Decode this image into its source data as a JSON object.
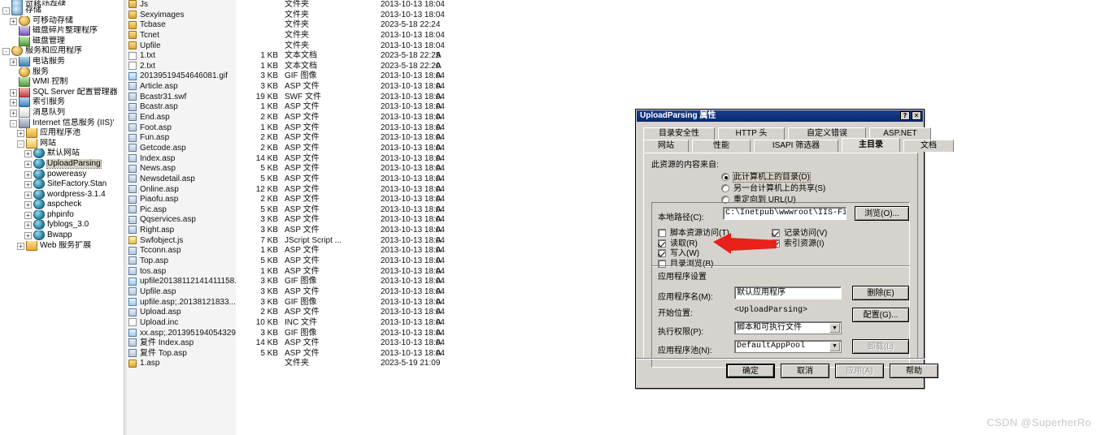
{
  "tree": {
    "items": [
      {
        "label": "可移动存储",
        "indent": 0,
        "expander": "none",
        "icon": "disk-icon",
        "cut": true
      },
      {
        "label": "存储",
        "indent": 0,
        "expander": "-",
        "icon": "disk-icon"
      },
      {
        "label": "可移动存储",
        "indent": 1,
        "expander": "+",
        "icon": "gear-icon"
      },
      {
        "label": "磁盘碎片整理程序",
        "indent": 1,
        "expander": "none",
        "icon": "purple-icon"
      },
      {
        "label": "磁盘管理",
        "indent": 1,
        "expander": "none",
        "icon": "green-icon"
      },
      {
        "label": "服务和应用程序",
        "indent": 0,
        "expander": "-",
        "icon": "gear-icon"
      },
      {
        "label": "电话服务",
        "indent": 1,
        "expander": "+",
        "icon": "blue-icon"
      },
      {
        "label": "服务",
        "indent": 1,
        "expander": "none",
        "icon": "gear-icon"
      },
      {
        "label": "WMI 控制",
        "indent": 1,
        "expander": "none",
        "icon": "green-icon"
      },
      {
        "label": "SQL Server 配置管理器",
        "indent": 1,
        "expander": "+",
        "icon": "red-icon"
      },
      {
        "label": "索引服务",
        "indent": 1,
        "expander": "+",
        "icon": "blue-icon"
      },
      {
        "label": "消息队列",
        "indent": 1,
        "expander": "+",
        "icon": "mail-icon"
      },
      {
        "label": "Internet 信息服务 (IIS)'",
        "indent": 1,
        "expander": "-",
        "icon": "computer-icon"
      },
      {
        "label": "应用程序池",
        "indent": 2,
        "expander": "+",
        "icon": "folder-icon"
      },
      {
        "label": "网站",
        "indent": 2,
        "expander": "-",
        "icon": "folder-open-icon"
      },
      {
        "label": "默认网站",
        "indent": 3,
        "expander": "+",
        "icon": "globe-icon"
      },
      {
        "label": "UploadParsing",
        "indent": 3,
        "expander": "+",
        "icon": "globe-icon",
        "selected": true
      },
      {
        "label": "powereasy",
        "indent": 3,
        "expander": "+",
        "icon": "globe-icon"
      },
      {
        "label": "SiteFactory.Stan",
        "indent": 3,
        "expander": "+",
        "icon": "globe-icon"
      },
      {
        "label": "wordpress-3.1.4",
        "indent": 3,
        "expander": "+",
        "icon": "globe-icon"
      },
      {
        "label": "aspcheck",
        "indent": 3,
        "expander": "+",
        "icon": "globe-icon"
      },
      {
        "label": "phpinfo",
        "indent": 3,
        "expander": "+",
        "icon": "globe-icon"
      },
      {
        "label": "fyblogs_3.0",
        "indent": 3,
        "expander": "+",
        "icon": "globe-icon"
      },
      {
        "label": "Bwapp",
        "indent": 3,
        "expander": "+",
        "icon": "globe-icon"
      },
      {
        "label": "Web 服务扩展",
        "indent": 2,
        "expander": "+",
        "icon": "folder-icon"
      }
    ]
  },
  "filelist": {
    "columns": [
      "名称",
      "大小",
      "类型",
      "修改日期",
      "属性"
    ],
    "rows": [
      {
        "name": "Js",
        "icon": "folder-icon",
        "size": "",
        "type": "文件夹",
        "date": "2013-10-13 18:04",
        "attr": ""
      },
      {
        "name": "Sexyimages",
        "icon": "folder-icon",
        "size": "",
        "type": "文件夹",
        "date": "2013-10-13 18:04",
        "attr": ""
      },
      {
        "name": "Tcbase",
        "icon": "folder-icon",
        "size": "",
        "type": "文件夹",
        "date": "2023-5-18 22:24",
        "attr": ""
      },
      {
        "name": "Tcnet",
        "icon": "folder-icon",
        "size": "",
        "type": "文件夹",
        "date": "2013-10-13 18:04",
        "attr": ""
      },
      {
        "name": "Upfile",
        "icon": "folder-icon",
        "size": "",
        "type": "文件夹",
        "date": "2013-10-13 18:04",
        "attr": ""
      },
      {
        "name": "1.txt",
        "icon": "txt-icon",
        "size": "1 KB",
        "type": "文本文档",
        "date": "2023-5-18 22:25",
        "attr": "A"
      },
      {
        "name": "2.txt",
        "icon": "txt-icon",
        "size": "1 KB",
        "type": "文本文档",
        "date": "2023-5-18 22:20",
        "attr": "A"
      },
      {
        "name": "20139519454646081.gif",
        "icon": "gif-icon",
        "size": "3 KB",
        "type": "GIF 图像",
        "date": "2013-10-13 18:04",
        "attr": "A"
      },
      {
        "name": "Article.asp",
        "icon": "asp-icon",
        "size": "3 KB",
        "type": "ASP 文件",
        "date": "2013-10-13 18:04",
        "attr": "A"
      },
      {
        "name": "Bcastr31.swf",
        "icon": "swf-icon",
        "size": "19 KB",
        "type": "SWF 文件",
        "date": "2013-10-13 18:04",
        "attr": "A"
      },
      {
        "name": "Bcastr.asp",
        "icon": "asp-icon",
        "size": "1 KB",
        "type": "ASP 文件",
        "date": "2013-10-13 18:04",
        "attr": "A"
      },
      {
        "name": "End.asp",
        "icon": "asp-icon",
        "size": "2 KB",
        "type": "ASP 文件",
        "date": "2013-10-13 18:04",
        "attr": "A"
      },
      {
        "name": "Foot.asp",
        "icon": "asp-icon",
        "size": "1 KB",
        "type": "ASP 文件",
        "date": "2013-10-13 18:04",
        "attr": "A"
      },
      {
        "name": "Fun.asp",
        "icon": "asp-icon",
        "size": "2 KB",
        "type": "ASP 文件",
        "date": "2013-10-13 18:04",
        "attr": "A"
      },
      {
        "name": "Getcode.asp",
        "icon": "asp-icon",
        "size": "2 KB",
        "type": "ASP 文件",
        "date": "2013-10-13 18:04",
        "attr": "A"
      },
      {
        "name": "Index.asp",
        "icon": "asp-icon",
        "size": "14 KB",
        "type": "ASP 文件",
        "date": "2013-10-13 18:04",
        "attr": "A"
      },
      {
        "name": "News.asp",
        "icon": "asp-icon",
        "size": "5 KB",
        "type": "ASP 文件",
        "date": "2013-10-13 18:04",
        "attr": "A"
      },
      {
        "name": "Newsdetail.asp",
        "icon": "asp-icon",
        "size": "5 KB",
        "type": "ASP 文件",
        "date": "2013-10-13 18:04",
        "attr": "A"
      },
      {
        "name": "Online.asp",
        "icon": "asp-icon",
        "size": "12 KB",
        "type": "ASP 文件",
        "date": "2013-10-13 18:04",
        "attr": "A"
      },
      {
        "name": "Piaofu.asp",
        "icon": "asp-icon",
        "size": "2 KB",
        "type": "ASP 文件",
        "date": "2013-10-13 18:04",
        "attr": "A"
      },
      {
        "name": "Pic.asp",
        "icon": "asp-icon",
        "size": "5 KB",
        "type": "ASP 文件",
        "date": "2013-10-13 18:04",
        "attr": "A"
      },
      {
        "name": "Qqservices.asp",
        "icon": "asp-icon",
        "size": "3 KB",
        "type": "ASP 文件",
        "date": "2013-10-13 18:04",
        "attr": "A"
      },
      {
        "name": "Right.asp",
        "icon": "asp-icon",
        "size": "3 KB",
        "type": "ASP 文件",
        "date": "2013-10-13 18:04",
        "attr": "A"
      },
      {
        "name": "Swfobject.js",
        "icon": "js-icon",
        "size": "7 KB",
        "type": "JScript Script ...",
        "date": "2013-10-13 18:04",
        "attr": "A"
      },
      {
        "name": "Tcconn.asp",
        "icon": "asp-icon",
        "size": "1 KB",
        "type": "ASP 文件",
        "date": "2013-10-13 18:04",
        "attr": "A"
      },
      {
        "name": "Top.asp",
        "icon": "asp-icon",
        "size": "5 KB",
        "type": "ASP 文件",
        "date": "2013-10-13 18:04",
        "attr": "A"
      },
      {
        "name": "tos.asp",
        "icon": "asp-icon",
        "size": "1 KB",
        "type": "ASP 文件",
        "date": "2013-10-13 18:04",
        "attr": "A"
      },
      {
        "name": "upfile20138112141411158...",
        "icon": "gif-icon",
        "size": "3 KB",
        "type": "GIF 图像",
        "date": "2013-10-13 18:04",
        "attr": "A"
      },
      {
        "name": "Upfile.asp",
        "icon": "asp-icon",
        "size": "3 KB",
        "type": "ASP 文件",
        "date": "2013-10-13 18:04",
        "attr": "A"
      },
      {
        "name": "upfile.asp;.20138121833...",
        "icon": "gif-icon",
        "size": "3 KB",
        "type": "GIF 图像",
        "date": "2013-10-13 18:04",
        "attr": "A"
      },
      {
        "name": "Upload.asp",
        "icon": "asp-icon",
        "size": "2 KB",
        "type": "ASP 文件",
        "date": "2013-10-13 18:04",
        "attr": "A"
      },
      {
        "name": "Upload.inc",
        "icon": "inc-icon",
        "size": "10 KB",
        "type": "INC 文件",
        "date": "2013-10-13 18:04",
        "attr": "A"
      },
      {
        "name": "xx.asp;.201395194054329...",
        "icon": "gif-icon",
        "size": "3 KB",
        "type": "GIF 图像",
        "date": "2013-10-13 18:04",
        "attr": "A"
      },
      {
        "name": "复件 Index.asp",
        "icon": "asp-icon",
        "size": "14 KB",
        "type": "ASP 文件",
        "date": "2013-10-13 18:04",
        "attr": "A"
      },
      {
        "name": "复件 Top.asp",
        "icon": "asp-icon",
        "size": "5 KB",
        "type": "ASP 文件",
        "date": "2013-10-13 18:04",
        "attr": "A"
      },
      {
        "name": "1.asp",
        "icon": "folder-icon",
        "size": "",
        "type": "文件夹",
        "date": "2023-5-19 21:09",
        "attr": ""
      }
    ]
  },
  "dialog": {
    "title": "UploadParsing 属性",
    "help_button": "?",
    "close_button": "✕",
    "tabs_row1": [
      "目录安全性",
      "HTTP 头",
      "自定义错误",
      "ASP.NET"
    ],
    "tabs_row2": [
      "网站",
      "性能",
      "ISAPI 筛选器",
      "主目录",
      "文档"
    ],
    "active_tab": "主目录",
    "content_source_label": "此资源的内容来自:",
    "radios": [
      {
        "label": "此计算机上的目录(D)",
        "selected": true
      },
      {
        "label": "另一台计算机上的共享(S)",
        "selected": false
      },
      {
        "label": "重定向到 URL(U)",
        "selected": false
      }
    ],
    "local_path_label": "本地路径(C):",
    "local_path_value": "C:\\Inetpub\\wwwroot\\IIS-FileParsin",
    "browse_button": "浏览(O)...",
    "checkboxes_left": [
      {
        "label": "脚本资源访问(T)",
        "checked": false
      },
      {
        "label": "读取(R)",
        "checked": true
      },
      {
        "label": "写入(W)",
        "checked": true
      },
      {
        "label": "目录浏览(B)",
        "checked": false
      }
    ],
    "checkboxes_right": [
      {
        "label": "记录访问(V)",
        "checked": true
      },
      {
        "label": "索引资源(I)",
        "checked": true
      }
    ],
    "app_settings_label": "应用程序设置",
    "app_name_label": "应用程序名(M):",
    "app_name_value": "默认应用程序",
    "start_point_label": "开始位置:",
    "start_point_value": "<UploadParsing>",
    "exec_perm_label": "执行权限(P):",
    "exec_perm_value": "脚本和可执行文件",
    "app_pool_label": "应用程序池(N):",
    "app_pool_value": "DefaultAppPool",
    "remove_button": "删除(E)",
    "config_button": "配置(G)...",
    "unload_button": "卸载(L)",
    "ok_button": "确定",
    "cancel_button": "取消",
    "apply_button": "应用(A)",
    "help_footer_button": "帮助"
  },
  "annotation": {
    "arrow_color": "#e8211a"
  },
  "watermark": {
    "text": "CSDN @SuperherRo"
  }
}
